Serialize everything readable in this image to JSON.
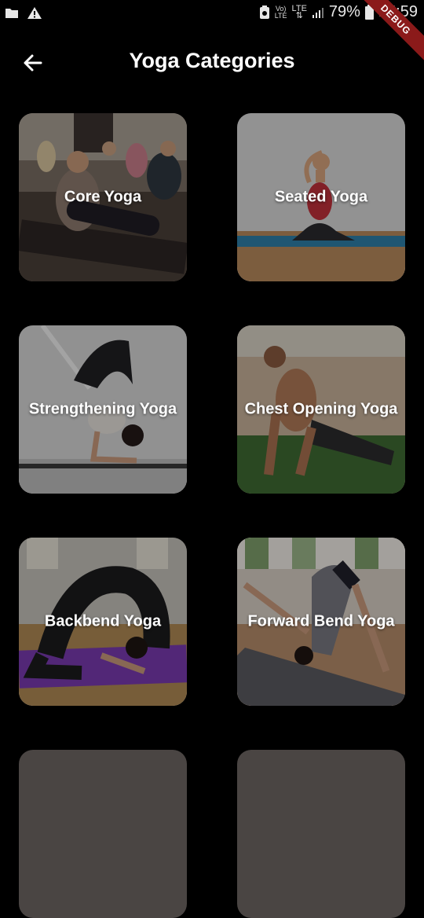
{
  "status_bar": {
    "battery": "79%",
    "time": "15:59",
    "network_top": "Vo)",
    "network_bottom": "LTE",
    "lte_label": "LTE",
    "debug_label": "DEBUG",
    "icons": [
      "folder-icon",
      "warning-icon",
      "data-saver-icon",
      "signal-icon",
      "battery-icon"
    ]
  },
  "app_bar": {
    "title": "Yoga Categories",
    "back_icon": "arrow-left-icon"
  },
  "categories": [
    {
      "label": "Core Yoga"
    },
    {
      "label": "Seated Yoga"
    },
    {
      "label": "Strengthening Yoga"
    },
    {
      "label": "Chest Opening Yoga"
    },
    {
      "label": "Backbend Yoga"
    },
    {
      "label": "Forward Bend Yoga"
    }
  ],
  "colors": {
    "background": "#000000",
    "text": "#ffffff",
    "debug_banner": "#8b1a1a"
  }
}
